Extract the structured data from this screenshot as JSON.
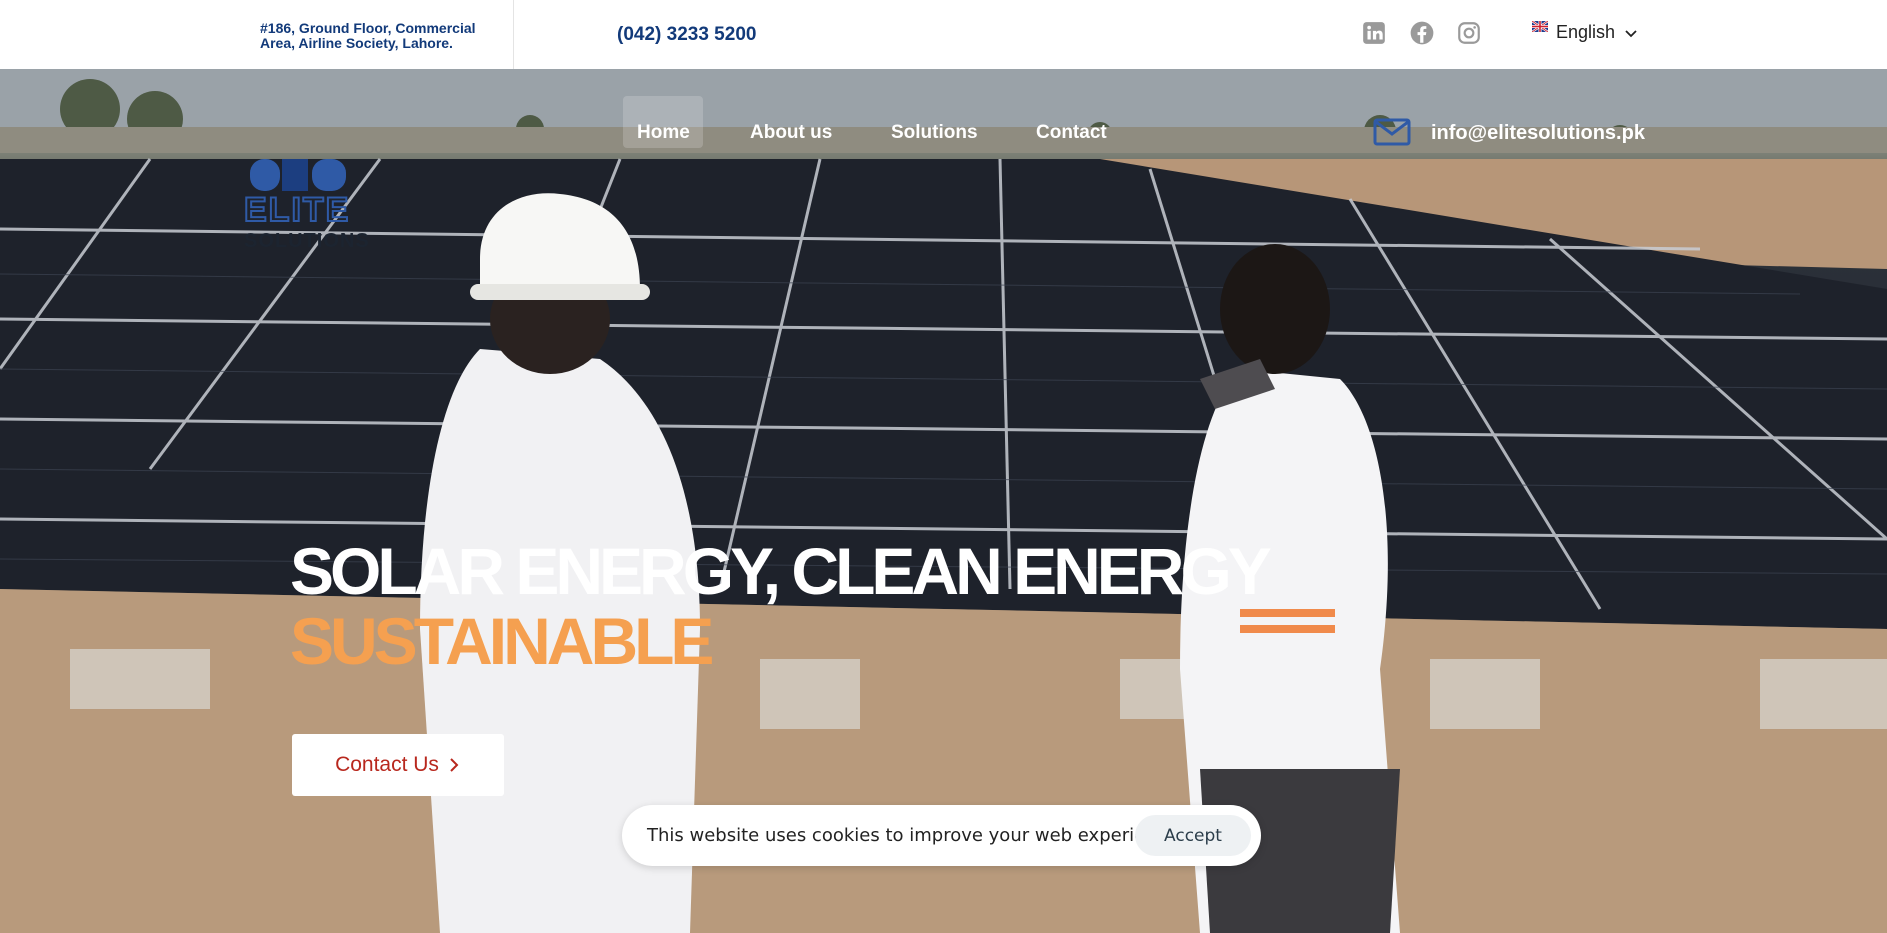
{
  "topbar": {
    "address": "#186, Ground Floor, Commercial Area, Airline Society, Lahore.",
    "phone": "(042) 3233 5200",
    "social": [
      {
        "name": "linkedin-icon"
      },
      {
        "name": "facebook-icon"
      },
      {
        "name": "instagram-icon"
      }
    ],
    "language": {
      "label": "English",
      "icon": "uk-flag-icon"
    }
  },
  "logo": {
    "line1": "ELITE",
    "line2": "SOLUTIONS"
  },
  "nav": {
    "items": [
      {
        "label": "Home",
        "active": true
      },
      {
        "label": "About us"
      },
      {
        "label": "Solutions"
      },
      {
        "label": "Contact"
      }
    ],
    "email": "info@elitesolutions.pk"
  },
  "hero": {
    "headline_line1": "SOLAR ENERGY, CLEAN ENERGY",
    "headline_line2": "SUSTAINABLE",
    "cta_label": "Contact Us"
  },
  "cookie": {
    "message": "This website uses cookies to improve your web experience.",
    "accept_label": "Accept"
  },
  "colors": {
    "brand_blue": "#123a7a",
    "accent_orange": "#f5a050",
    "cta_red": "#b8281e"
  }
}
